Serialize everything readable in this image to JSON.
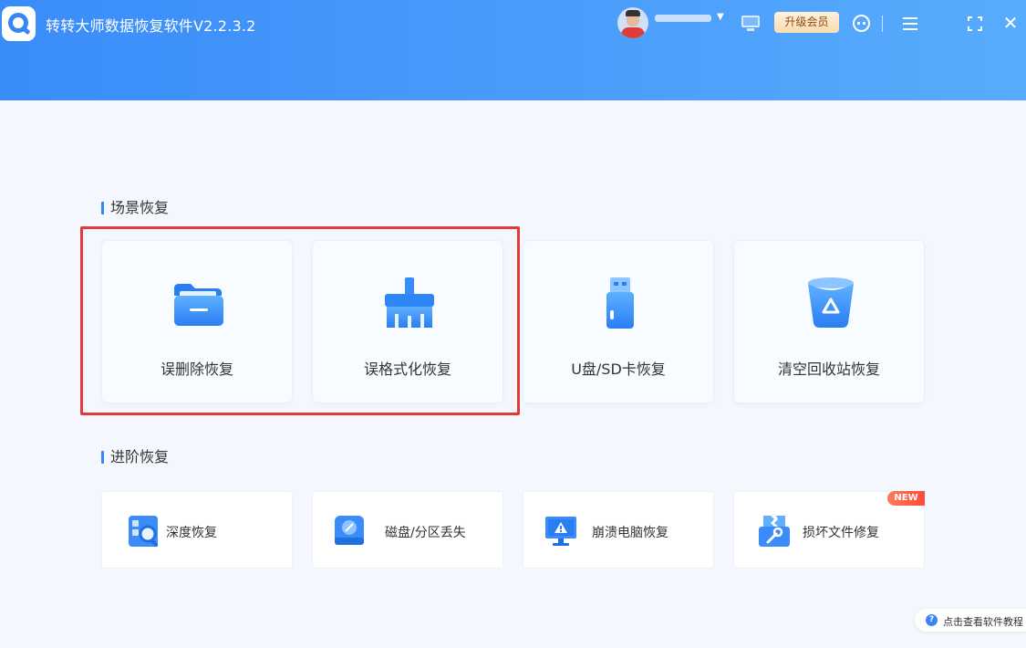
{
  "app": {
    "title": "转转大师数据恢复软件V2.2.3.2",
    "accent_color": "#3a8cf9"
  },
  "titlebar": {
    "upgrade_label": "升级会员",
    "user_caret": "▼",
    "close_glyph": "✕",
    "icons": [
      "avatar",
      "monitor-icon",
      "support-icon",
      "menu-icon",
      "fullscreen-icon",
      "close-icon"
    ]
  },
  "scene": {
    "title": "场景恢复",
    "cards": [
      {
        "label": "误删除恢复",
        "icon": "folder-icon"
      },
      {
        "label": "误格式化恢复",
        "icon": "broom-icon"
      },
      {
        "label": "U盘/SD卡恢复",
        "icon": "usb-drive-icon"
      },
      {
        "label": "清空回收站恢复",
        "icon": "recycle-bin-icon"
      }
    ],
    "highlight_color": "#e23b3b"
  },
  "advanced": {
    "title": "进阶恢复",
    "cards": [
      {
        "label": "深度恢复",
        "icon": "deep-scan-icon"
      },
      {
        "label": "磁盘/分区丢失",
        "icon": "disk-icon"
      },
      {
        "label": "崩溃电脑恢复",
        "icon": "crashed-pc-icon"
      },
      {
        "label": "损坏文件修复",
        "icon": "file-repair-icon",
        "badge": "NEW"
      }
    ]
  },
  "help": {
    "label": "点击查看软件教程",
    "icon_glyph": "?"
  }
}
